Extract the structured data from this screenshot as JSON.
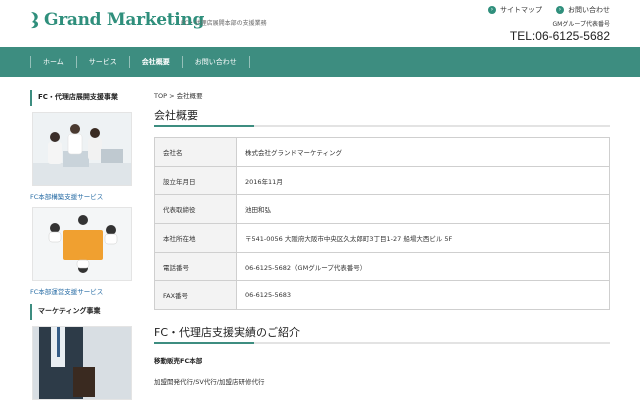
{
  "header": {
    "logo_text": "Grand Marketing",
    "tagline": "FC・代理店展開本部の支援業務",
    "top_links": [
      {
        "label": "サイトマップ",
        "icon": "arrow-right-icon"
      },
      {
        "label": "お問い合わせ",
        "icon": "arrow-right-icon"
      }
    ],
    "gm_note": "GMグループ代表番号",
    "tel": "TEL:06-6125-5682"
  },
  "nav": {
    "items": [
      {
        "label": "ホーム"
      },
      {
        "label": "サービス"
      },
      {
        "label": "会社概要",
        "active": true
      },
      {
        "label": "お問い合わせ"
      }
    ]
  },
  "sidebar": {
    "heading1": "FC・代理店展開支援事業",
    "link1": "FC本部構築支援サービス",
    "link2": "FC本部運営支援サービス",
    "heading2": "マーケティング事業"
  },
  "main": {
    "breadcrumb": {
      "top": "TOP",
      "sep": ">",
      "current": "会社概要"
    },
    "title": "会社概要",
    "table": [
      {
        "label": "会社名",
        "value": "株式会社グランドマーケティング"
      },
      {
        "label": "設立年月日",
        "value": "2016年11月"
      },
      {
        "label": "代表取締役",
        "value": "池田和弘"
      },
      {
        "label": "本社所在地",
        "value": "〒541-0056  大阪府大阪市中央区久太郎町3丁目1-27  船場大西ビル  5F"
      },
      {
        "label": "電話番号",
        "value": "06-6125-5682（GMグループ代表番号）"
      },
      {
        "label": "FAX番号",
        "value": "06-6125-5683"
      }
    ],
    "section_title": "FC・代理店支援実績のご紹介",
    "sub_heading": "移動販売FC本部",
    "sub_text": "加盟開発代行/SV代行/加盟店研修代行"
  },
  "colors": {
    "brand": "#3d8d80",
    "logo": "#2f8f7c",
    "link": "#2a6ea6"
  }
}
